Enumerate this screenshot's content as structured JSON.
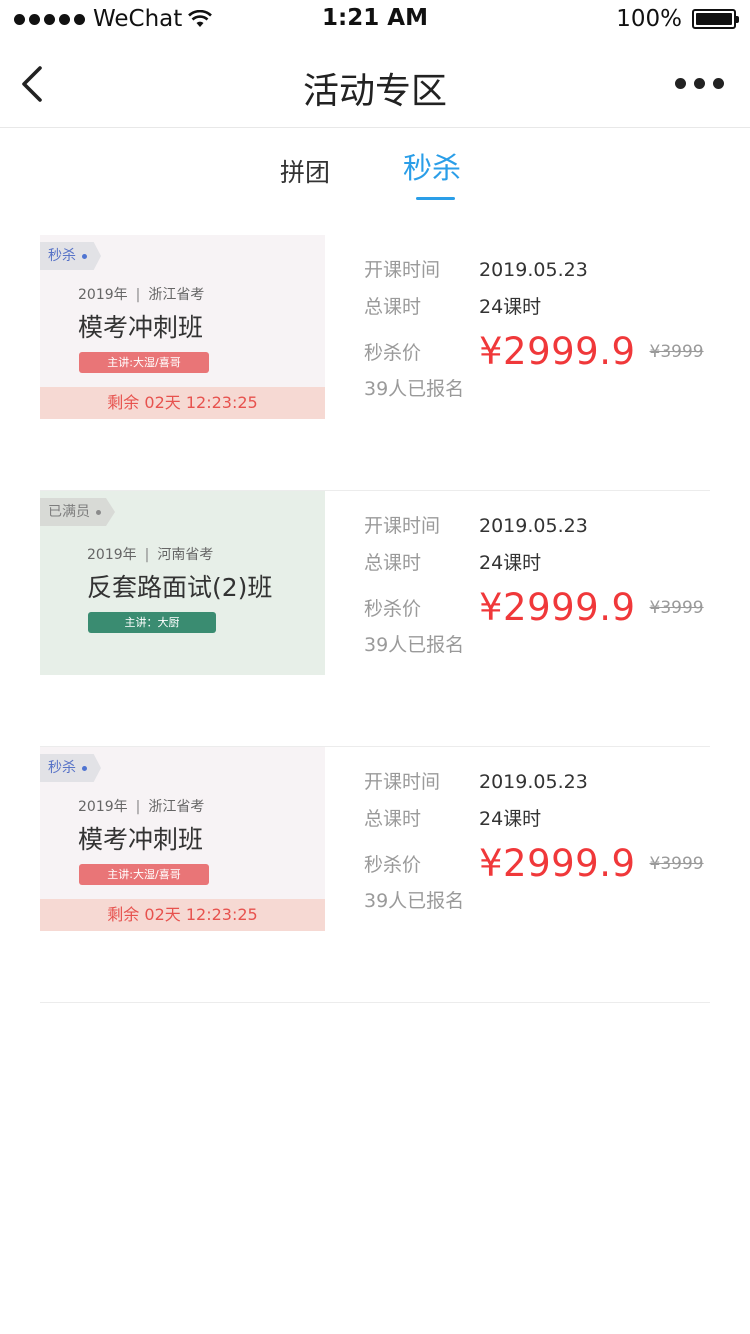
{
  "status_bar": {
    "carrier": "WeChat",
    "time": "1:21 AM",
    "battery": "100%",
    "battery_level": 1.0
  },
  "nav": {
    "title": "活动专区"
  },
  "tabs": [
    {
      "label": "拼团",
      "active": false
    },
    {
      "label": "秒杀",
      "active": true
    }
  ],
  "colors": {
    "accent": "#2a9ee8",
    "price": "#f0383a"
  },
  "courses": [
    {
      "badge": "秒杀",
      "year": "2019年",
      "region": "浙江省考",
      "title": "模考冲刺班",
      "teacher": "主讲:大湿/喜哥",
      "countdown": "剩余 02天 12:23:25",
      "start_label": "开课时间",
      "start_value": "2019.05.23",
      "hours_label": "总课时",
      "hours_value": "24课时",
      "price_label": "秒杀价",
      "price": "¥2999.9",
      "original_price": "¥3999",
      "enrolled": "39人已报名"
    },
    {
      "badge": "已满员",
      "year": "2019年",
      "region": "河南省考",
      "title": "反套路面试(2)班",
      "teacher": "主讲：大厨",
      "start_label": "开课时间",
      "start_value": "2019.05.23",
      "hours_label": "总课时",
      "hours_value": "24课时",
      "price_label": "秒杀价",
      "price": "¥2999.9",
      "original_price": "¥3999",
      "enrolled": "39人已报名"
    },
    {
      "badge": "秒杀",
      "year": "2019年",
      "region": "浙江省考",
      "title": "模考冲刺班",
      "teacher": "主讲:大湿/喜哥",
      "countdown": "剩余 02天 12:23:25",
      "start_label": "开课时间",
      "start_value": "2019.05.23",
      "hours_label": "总课时",
      "hours_value": "24课时",
      "price_label": "秒杀价",
      "price": "¥2999.9",
      "original_price": "¥3999",
      "enrolled": "39人已报名"
    }
  ]
}
